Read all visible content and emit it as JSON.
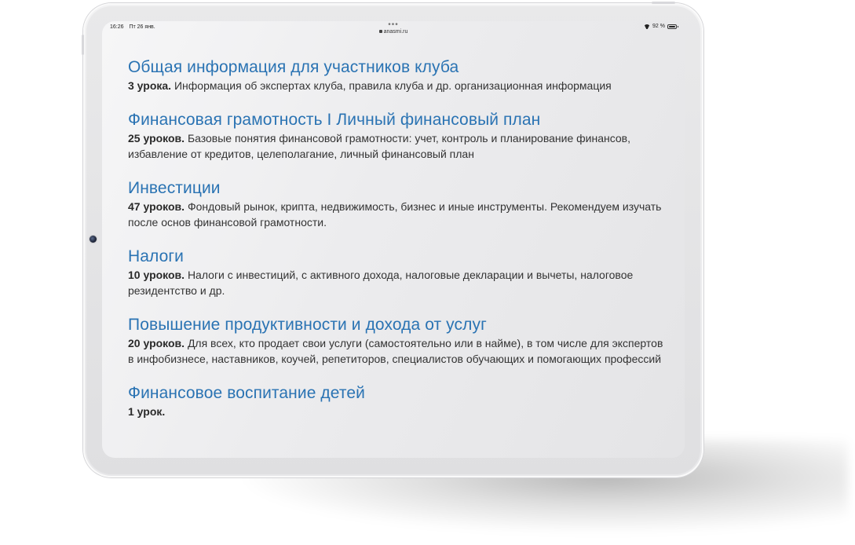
{
  "status_bar": {
    "time": "16:26",
    "date": "Пт 26 янв.",
    "url": "anasmi.ru",
    "battery": "92 %"
  },
  "sections": [
    {
      "title": "Общая информация для участников клуба",
      "count": "3 урока.",
      "description": "Информация об экспертах клуба, правила клуба и др. организационная информация"
    },
    {
      "title": "Финансовая грамотность I Личный финансовый план",
      "count": "25 уроков.",
      "description": "Базовые понятия финансовой грамотности: учет, контроль и планирование финансов, избавление от кредитов, целеполагание, личный финансовый план"
    },
    {
      "title": "Инвестиции",
      "count": "47 уроков.",
      "description": "Фондовый рынок, крипта, недвижимость, бизнес и иные инструменты. Рекомендуем изучать после основ финансовой грамотности."
    },
    {
      "title": "Налоги",
      "count": "10 уроков.",
      "description": "Налоги с инвестиций, с активного дохода, налоговые декларации и вычеты, налоговое резидентство и др."
    },
    {
      "title": "Повышение продуктивности и дохода от услуг",
      "count": "20 уроков.",
      "description": "Для всех, кто продает свои услуги (самостоятельно или в найме), в том числе для экспертов в инфобизнесе, наставников, коучей, репетиторов, специалистов обучающих и помогающих профессий"
    },
    {
      "title": "Финансовое воспитание детей",
      "count": "1 урок.",
      "description": ""
    }
  ]
}
